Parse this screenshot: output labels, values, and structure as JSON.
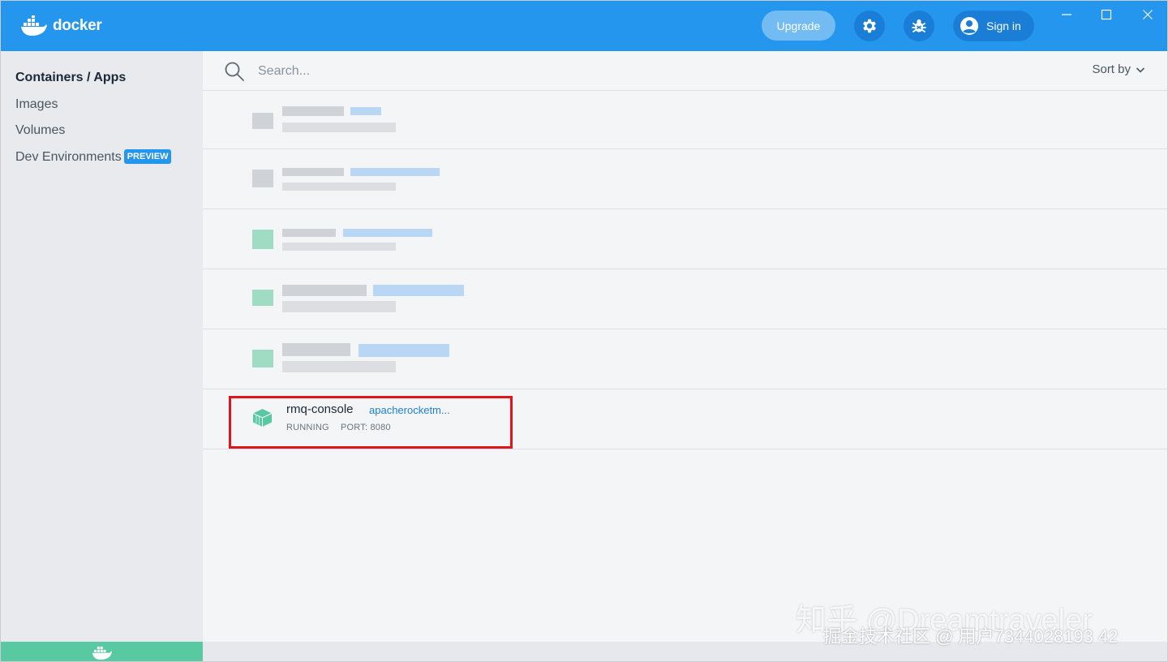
{
  "app": {
    "title": "docker"
  },
  "header": {
    "upgrade_label": "Upgrade",
    "signin_label": "Sign in"
  },
  "icons": {
    "logo": "docker-whale-icon",
    "settings": "gear-icon",
    "troubleshoot": "bug-icon",
    "account": "user-circle-icon",
    "search": "search-icon",
    "sort": "chevron-down-icon",
    "container": "container-cube-icon"
  },
  "sidebar": {
    "items": [
      {
        "label": "Containers / Apps"
      },
      {
        "label": "Images"
      },
      {
        "label": "Volumes"
      },
      {
        "label": "Dev Environments",
        "badge": "PREVIEW"
      }
    ]
  },
  "search": {
    "placeholder": "Search...",
    "value": ""
  },
  "sort": {
    "label": "Sort by"
  },
  "containers": {
    "highlighted": {
      "name": "rmq-console",
      "image": "apacherocketm...",
      "status": "RUNNING",
      "port": "PORT: 8080"
    }
  },
  "watermark": {
    "line1": "知乎 @Dreamtraveler",
    "line2": "掘金技术社区 @ 用户7344028193 42"
  },
  "colors": {
    "accent": "#2496ed",
    "running": "#58c9a1",
    "highlight_border": "#e0141b"
  }
}
